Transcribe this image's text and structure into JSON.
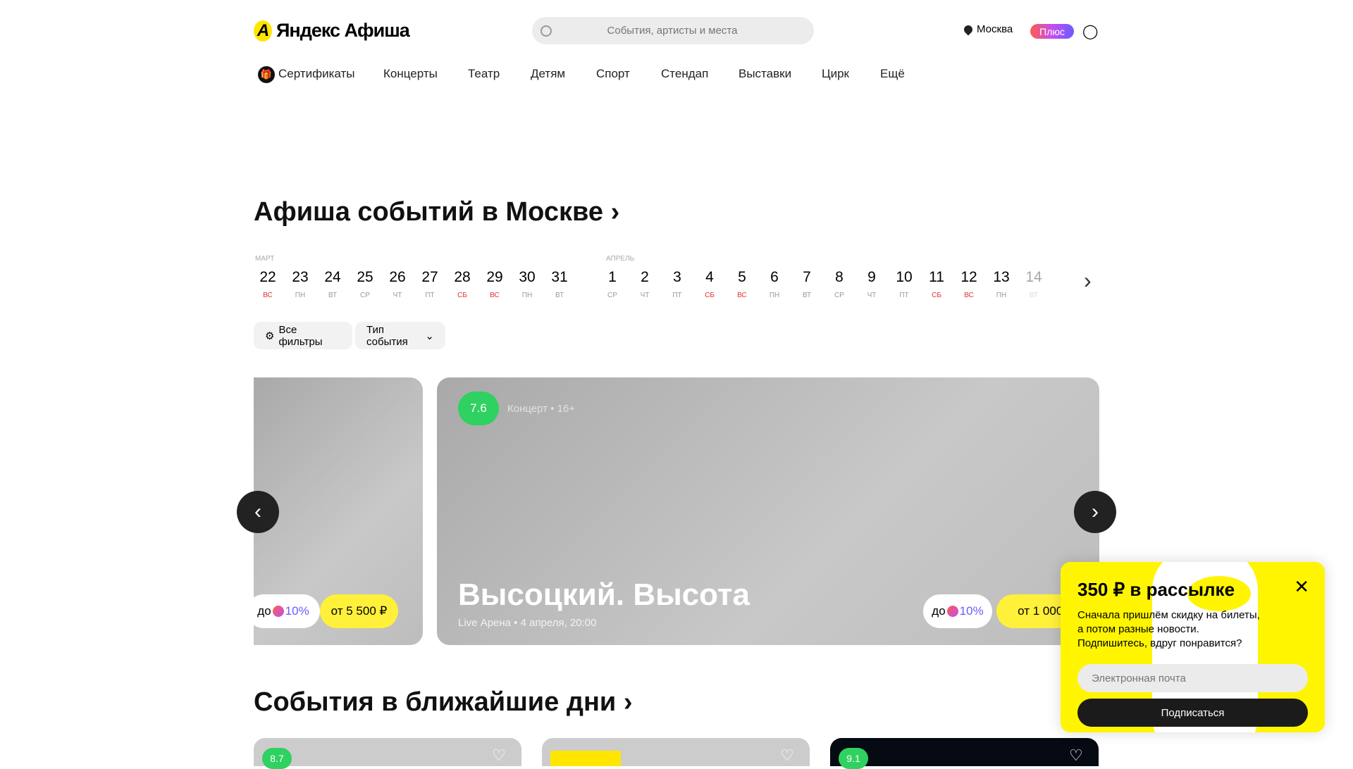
{
  "header": {
    "logo": "Яндекс Афиша",
    "search_placeholder": "События, артисты и места",
    "city": "Москва",
    "plus": "Плюс"
  },
  "nav": [
    "Сертификаты",
    "Концерты",
    "Театр",
    "Детям",
    "Спорт",
    "Стендап",
    "Выставки",
    "Цирк",
    "Ещё"
  ],
  "section1": {
    "title": "Афиша событий в Москве"
  },
  "calendar": {
    "months": [
      "МАРТ",
      "АПРЕЛЬ"
    ],
    "days": [
      {
        "n": "22",
        "w": "ВС",
        "red": true
      },
      {
        "n": "23",
        "w": "ПН"
      },
      {
        "n": "24",
        "w": "ВТ"
      },
      {
        "n": "25",
        "w": "СР"
      },
      {
        "n": "26",
        "w": "ЧТ"
      },
      {
        "n": "27",
        "w": "ПТ"
      },
      {
        "n": "28",
        "w": "СБ",
        "red": true
      },
      {
        "n": "29",
        "w": "ВС",
        "red": true
      },
      {
        "n": "30",
        "w": "ПН"
      },
      {
        "n": "31",
        "w": "ВТ"
      },
      {
        "n": "1",
        "w": "СР"
      },
      {
        "n": "2",
        "w": "ЧТ"
      },
      {
        "n": "3",
        "w": "ПТ"
      },
      {
        "n": "4",
        "w": "СБ",
        "red": true
      },
      {
        "n": "5",
        "w": "ВС",
        "red": true
      },
      {
        "n": "6",
        "w": "ПН"
      },
      {
        "n": "7",
        "w": "ВТ"
      },
      {
        "n": "8",
        "w": "СР"
      },
      {
        "n": "9",
        "w": "ЧТ"
      },
      {
        "n": "10",
        "w": "ПТ"
      },
      {
        "n": "11",
        "w": "СБ",
        "red": true
      },
      {
        "n": "12",
        "w": "ВС",
        "red": true
      },
      {
        "n": "13",
        "w": "ПН"
      },
      {
        "n": "14",
        "w": "ВТ",
        "fade": true
      }
    ]
  },
  "filters": {
    "all": "Все фильтры",
    "type": "Тип события"
  },
  "carousel": {
    "left_card": {
      "cashback_prefix": "до",
      "cashback": "10%",
      "price": "от 5 500 ₽"
    },
    "main_card": {
      "rating": "7.6",
      "category": "Концерт",
      "age": "16+",
      "sep": "•",
      "title": "Высоцкий. Высота",
      "subtitle": "Live Арена • 4 апреля, 20:00",
      "cashback_prefix": "до",
      "cashback": "10%",
      "price": "от 1 000 ₽"
    }
  },
  "section2": {
    "title": "События в ближайшие дни",
    "cards": [
      {
        "rating": "8.7"
      },
      {
        "rating": ""
      },
      {
        "rating": "9.1"
      }
    ]
  },
  "popup": {
    "title": "350 ₽ в рассылке",
    "text1": "Сначала пришлём скидку на билеты,",
    "text2": "а потом разные новости.",
    "text3": "Подпишитесь, вдруг понравится?",
    "email_placeholder": "Электронная почта",
    "button": "Подписаться"
  }
}
